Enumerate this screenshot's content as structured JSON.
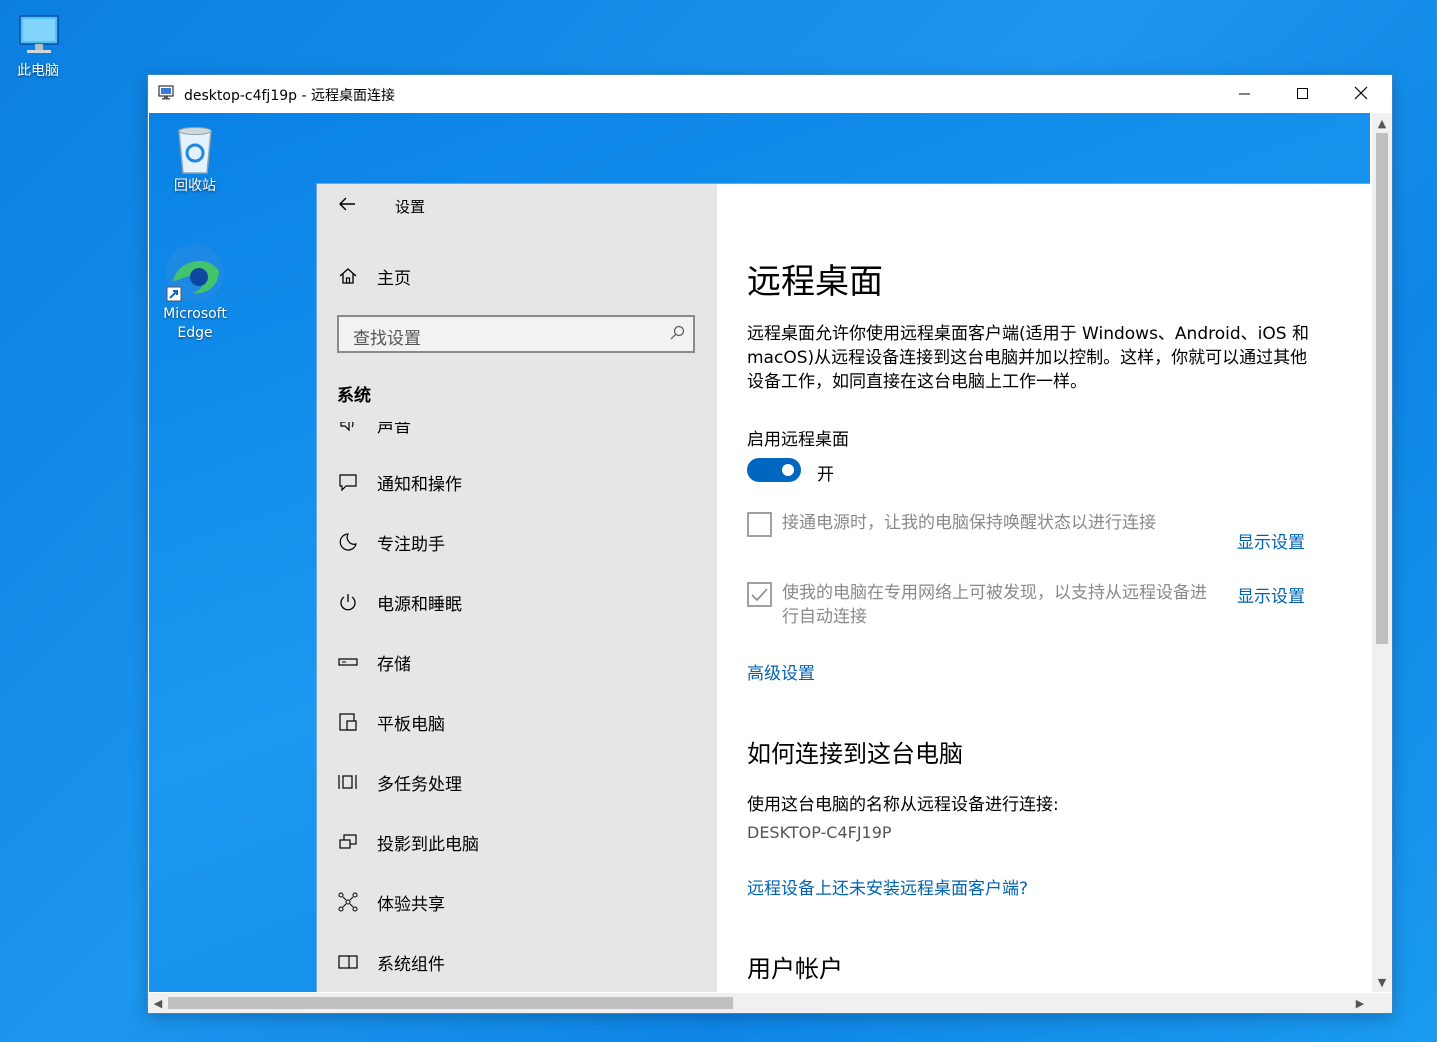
{
  "desktop": {
    "icons": [
      {
        "label": "此电脑"
      }
    ]
  },
  "rdp_window": {
    "title": "desktop-c4fj19p - 远程桌面连接",
    "remote_icons": [
      {
        "label": "回收站"
      },
      {
        "label_line1": "Microsoft",
        "label_line2": "Edge"
      }
    ]
  },
  "settings": {
    "header_title": "设置",
    "home_label": "主页",
    "search_placeholder": "查找设置",
    "section_title": "系统",
    "nav_items": [
      {
        "label": "声音",
        "icon": "speaker-icon"
      },
      {
        "label": "通知和操作",
        "icon": "notification-icon"
      },
      {
        "label": "专注助手",
        "icon": "moon-icon"
      },
      {
        "label": "电源和睡眠",
        "icon": "power-icon"
      },
      {
        "label": "存储",
        "icon": "storage-icon"
      },
      {
        "label": "平板电脑",
        "icon": "tablet-icon"
      },
      {
        "label": "多任务处理",
        "icon": "multitask-icon"
      },
      {
        "label": "投影到此电脑",
        "icon": "project-icon"
      },
      {
        "label": "体验共享",
        "icon": "share-icon"
      },
      {
        "label": "系统组件",
        "icon": "components-icon"
      }
    ],
    "page": {
      "title": "远程桌面",
      "description": "远程桌面允许你使用远程桌面客户端(适用于 Windows、Android、iOS 和 macOS)从远程设备连接到这台电脑并加以控制。这样，你就可以通过其他设备工作，如同直接在这台电脑上工作一样。",
      "enable_label": "启用远程桌面",
      "toggle_state": "开",
      "toggle_on": true,
      "option1_text": "接通电源时，让我的电脑保持唤醒状态以进行连接",
      "option1_checked": false,
      "option1_link": "显示设置",
      "option2_line1": "使我的电脑在专用网络上可被发现，以支持从远程设备进",
      "option2_line2": "行自动连接",
      "option2_checked": true,
      "option2_link": "显示设置",
      "advanced_link": "高级设置",
      "how_to_title": "如何连接到这台电脑",
      "how_to_text": "使用这台电脑的名称从远程设备进行连接:",
      "pc_name": "DESKTOP-C4FJ19P",
      "client_link": "远程设备上还未安装远程桌面客户端?",
      "accounts_title": "用户帐户"
    }
  },
  "colors": {
    "accent": "#0067c0",
    "link": "#0063b1",
    "sidebar_bg": "#e6e6e6",
    "desktop_blue": "#0a7fe0"
  }
}
